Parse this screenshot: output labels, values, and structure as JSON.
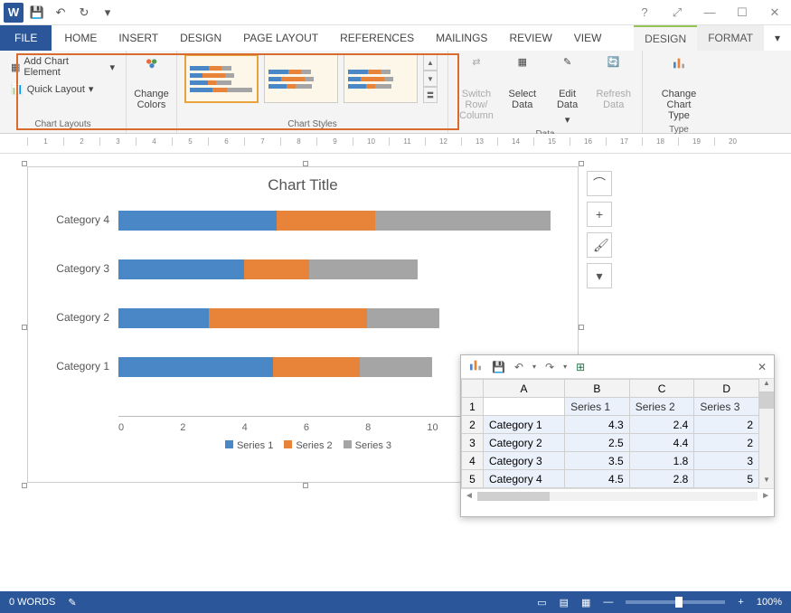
{
  "qat": {
    "save": "💾",
    "undo": "↶",
    "redo": "↻"
  },
  "tabs": {
    "file": "FILE",
    "home": "HOME",
    "insert": "INSERT",
    "design": "DESIGN",
    "pagelayout": "PAGE LAYOUT",
    "references": "REFERENCES",
    "mailings": "MAILINGS",
    "review": "REVIEW",
    "view": "VIEW",
    "ctx_design": "DESIGN",
    "ctx_format": "FORMAT"
  },
  "ribbon": {
    "layouts": {
      "add_element": "Add Chart Element",
      "quick_layout": "Quick Layout",
      "label": "Chart Layouts"
    },
    "colors": {
      "label": "Change Colors"
    },
    "styles": {
      "label": "Chart Styles"
    },
    "data": {
      "switch": "Switch Row/\nColumn",
      "select": "Select Data",
      "edit": "Edit Data",
      "refresh": "Refresh Data",
      "label": "Data"
    },
    "type": {
      "change": "Change Chart Type",
      "label": "Type"
    }
  },
  "chart_data": {
    "type": "bar",
    "title": "Chart Title",
    "categories": [
      "Category 1",
      "Category 2",
      "Category 3",
      "Category 4"
    ],
    "series": [
      {
        "name": "Series 1",
        "values": [
          4.3,
          2.5,
          3.5,
          4.5
        ]
      },
      {
        "name": "Series 2",
        "values": [
          2.4,
          4.4,
          1.8,
          2.8
        ]
      },
      {
        "name": "Series 3",
        "values": [
          2,
          2,
          3,
          5
        ]
      }
    ],
    "xlabel": "",
    "ylabel": "",
    "xlim": [
      0,
      12
    ],
    "ticks": [
      "0",
      "2",
      "4",
      "6",
      "8",
      "10",
      "12"
    ],
    "colors": [
      "#4a87c7",
      "#e8833a",
      "#a5a5a5"
    ]
  },
  "side_buttons": {
    "layout": "⌒",
    "add": "+",
    "style": "🖌",
    "filter": "▾"
  },
  "datasheet": {
    "cols": [
      "",
      "A",
      "B",
      "C",
      "D"
    ],
    "headers": [
      "",
      "Series 1",
      "Series 2",
      "Series 3"
    ],
    "rows": [
      [
        "Category 1",
        "4.3",
        "2.4",
        "2"
      ],
      [
        "Category 2",
        "2.5",
        "4.4",
        "2"
      ],
      [
        "Category 3",
        "3.5",
        "1.8",
        "3"
      ],
      [
        "Category 4",
        "4.5",
        "2.8",
        "5"
      ]
    ]
  },
  "status": {
    "words": "0 WORDS",
    "zoom": "100%"
  }
}
